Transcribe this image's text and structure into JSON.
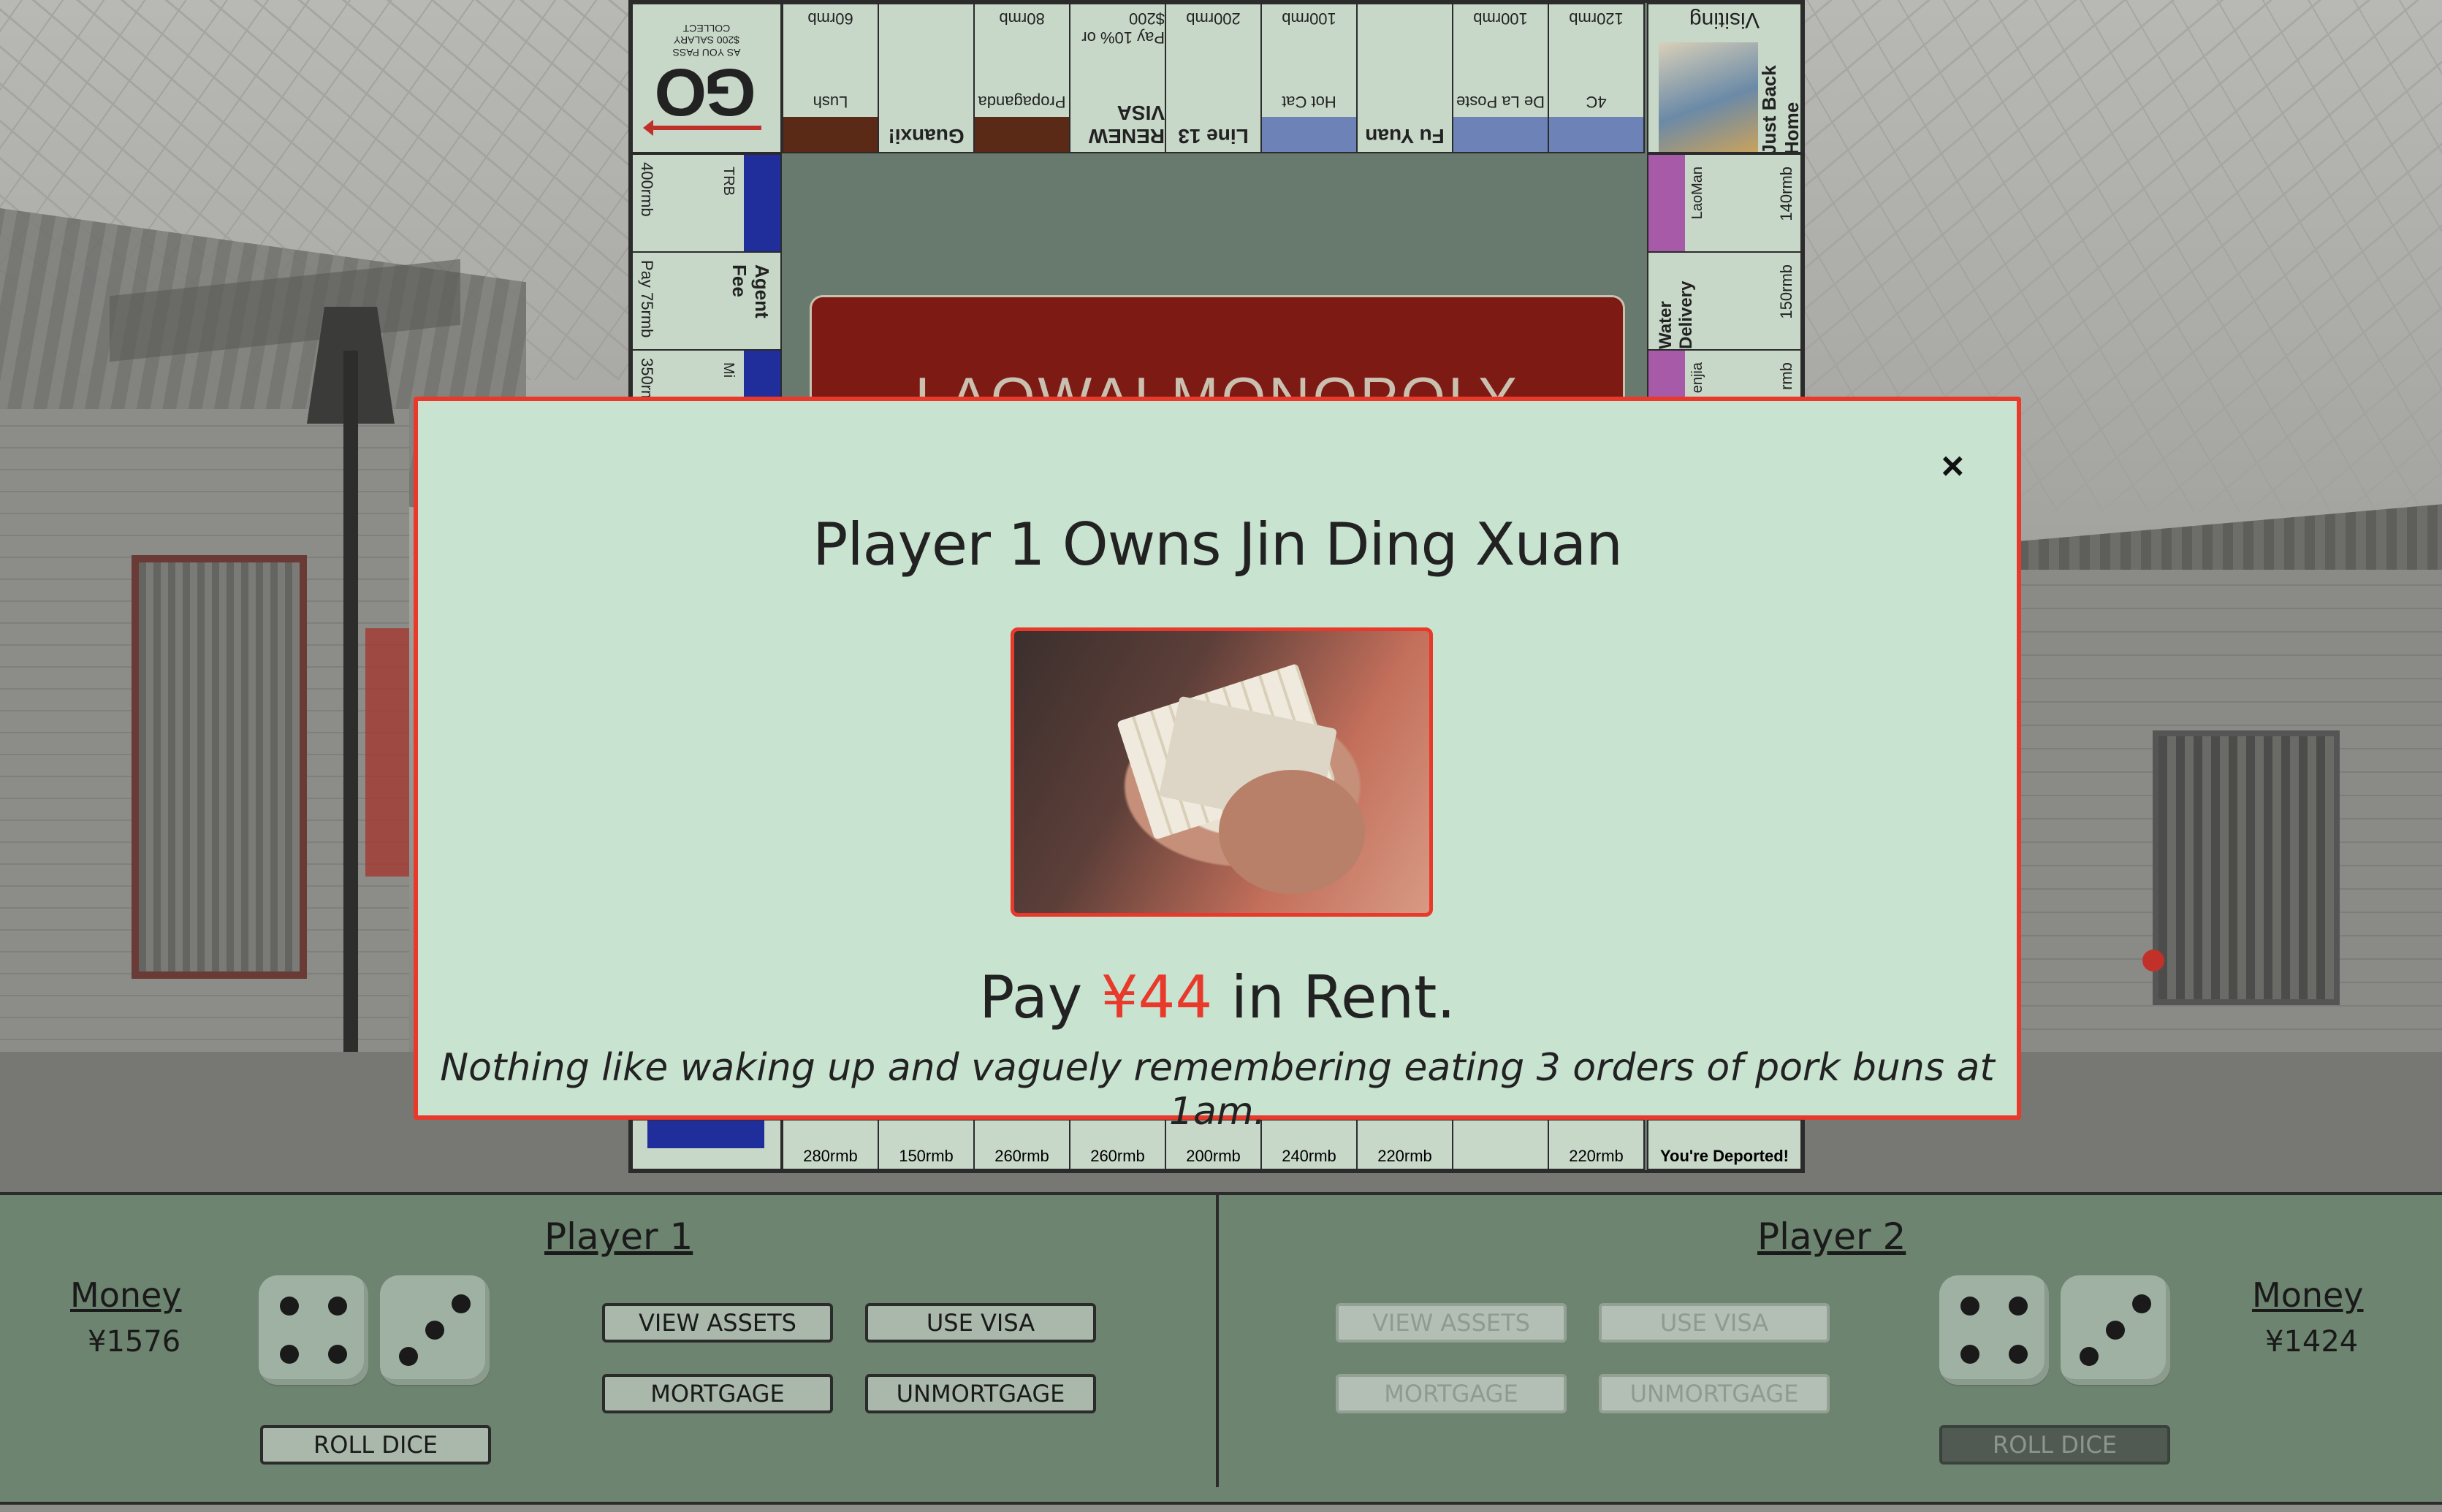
{
  "board": {
    "title": "LAOWAI MONOPOLY",
    "go": {
      "main": "GO",
      "sub1": "COLLECT",
      "sub2": "$200 SALARY",
      "sub3": "AS YOU PASS"
    },
    "visiting": {
      "label": "Visiting",
      "jail": "Just Back Home"
    },
    "top_spaces": [
      {
        "price": "60rmb",
        "name": "Lush",
        "color": "#5a2a17"
      },
      {
        "price": "",
        "name": "Guanxi!",
        "color": ""
      },
      {
        "price": "80rmb",
        "name": "Propaganda",
        "color": "#5a2a17"
      },
      {
        "price": "Pay 10% or $200",
        "name": "RENEW VISA",
        "color": ""
      },
      {
        "price": "200rmb",
        "name": "Line 13",
        "color": ""
      },
      {
        "price": "100rmb",
        "name": "Hot Cat",
        "color": "#6d83b8"
      },
      {
        "price": "",
        "name": "Fu Yuan",
        "color": ""
      },
      {
        "price": "100rmb",
        "name": "De La Poste",
        "color": "#6d83b8"
      },
      {
        "price": "120rmb",
        "name": "4C",
        "color": "#6d83b8"
      }
    ],
    "left_spaces": [
      {
        "price": "400rmb",
        "name": "TRB",
        "color": "#1f2e9a"
      },
      {
        "price": "Pay 75rmb",
        "name": "Agent Fee",
        "color": ""
      },
      {
        "price": "350rmb",
        "name": "Mi",
        "color": "#1f2e9a"
      }
    ],
    "right_spaces": [
      {
        "price": "140rmb",
        "name": "LaoMan",
        "color": "#a65aa8"
      },
      {
        "price": "150rmb",
        "name": "Water Delivery",
        "color": ""
      },
      {
        "price": "rmb",
        "name": "enjia",
        "color": "#a65aa8"
      }
    ],
    "bottom_spaces": [
      "280rmb",
      "150rmb",
      "260rmb",
      "260rmb",
      "200rmb",
      "240rmb",
      "220rmb",
      "",
      "220rmb"
    ],
    "bottom_corner": "You're Deported!"
  },
  "modal": {
    "title": "Player 1 Owns Jin Ding Xuan",
    "rent_prefix": "Pay ",
    "rent_amount": "¥44",
    "rent_suffix": " in Rent.",
    "quote": "Nothing like waking up and vaguely remembering eating 3 orders of pork buns at 1am.",
    "close": "×"
  },
  "players": [
    {
      "name": "Player 1",
      "money_label": "Money",
      "money": "¥1576",
      "dice": [
        4,
        3
      ],
      "buttons": {
        "view_assets": "VIEW ASSETS",
        "use_visa": "USE VISA",
        "mortgage": "MORTGAGE",
        "unmortgage": "UNMORTGAGE",
        "roll": "ROLL DICE"
      },
      "active": true
    },
    {
      "name": "Player 2",
      "money_label": "Money",
      "money": "¥1424",
      "dice": [
        4,
        3
      ],
      "buttons": {
        "view_assets": "VIEW ASSETS",
        "use_visa": "USE VISA",
        "mortgage": "MORTGAGE",
        "unmortgage": "UNMORTGAGE",
        "roll": "ROLL DICE"
      },
      "active": false
    }
  ],
  "colors": {
    "modal_border": "#e8392b",
    "modal_bg": "#c8e3cf",
    "panel_bg": "#6d8470",
    "rent_accent": "#e8392b"
  }
}
